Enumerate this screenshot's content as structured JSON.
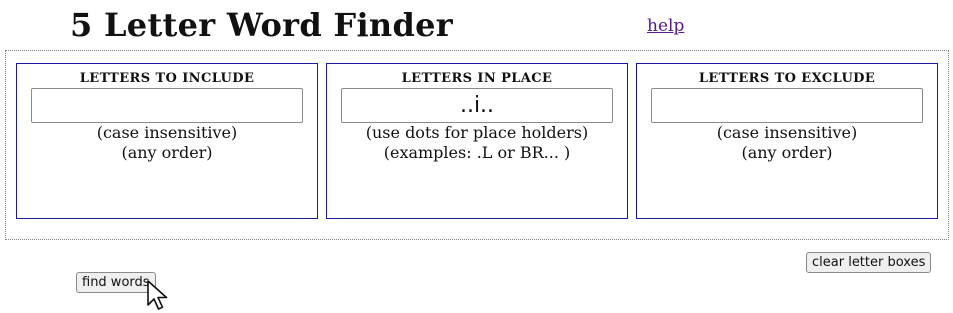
{
  "header": {
    "title": "5 Letter Word Finder",
    "help_link": "help"
  },
  "panels": [
    {
      "heading": "LETTERS TO INCLUDE",
      "value": "",
      "notes": [
        "(case insensitive)",
        "(any order)"
      ]
    },
    {
      "heading": "LETTERS IN PLACE",
      "value": "..i..",
      "notes": [
        "(use dots for place holders)",
        "(examples: .L or BR... )"
      ]
    },
    {
      "heading": "LETTERS TO EXCLUDE",
      "value": "",
      "notes": [
        "(case insensitive)",
        "(any order)"
      ]
    }
  ],
  "buttons": {
    "clear_label": "clear letter boxes",
    "find_label": "find words"
  },
  "cursor": {
    "icon": "arrow-pointer-icon"
  }
}
